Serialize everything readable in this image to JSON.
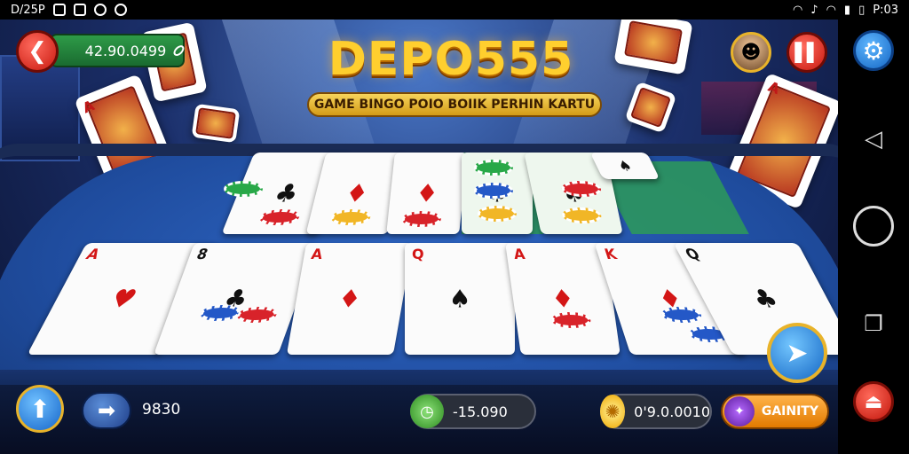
{
  "status_bar": {
    "time_left": "D/25P",
    "time_right": "P:03"
  },
  "title": {
    "logo": "DEPO555",
    "subtitle": "GAME BINGO POIO BOIIK PERHIN KARTU"
  },
  "top": {
    "balance": "42.90.0499"
  },
  "bottom": {
    "bet_value": "9830",
    "green_pill_value": "-15.090",
    "sun_pill_value": "0'9.0.0010",
    "action_label": "GAINITY"
  },
  "top_row_cards": [
    {
      "rank": "",
      "emblem": "♣"
    },
    {
      "rank": "",
      "emblem": "♦"
    },
    {
      "rank": "",
      "emblem": "♦"
    },
    {
      "rank": "",
      "emblem": "♠"
    },
    {
      "rank": "",
      "emblem": "♠"
    },
    {
      "rank": "",
      "emblem": "♠"
    }
  ],
  "bottom_row_cards": [
    {
      "rank": "A",
      "emblem": "♥"
    },
    {
      "rank": "8",
      "emblem": "♣"
    },
    {
      "rank": "A",
      "emblem": "♦"
    },
    {
      "rank": "Q",
      "emblem": "♠"
    },
    {
      "rank": "A",
      "emblem": "♦"
    },
    {
      "rank": "K",
      "emblem": "♦"
    },
    {
      "rank": "Q",
      "emblem": "♣"
    }
  ],
  "icons": {
    "back": "arrow-left-icon",
    "pause": "pause-icon",
    "settings": "gear-icon",
    "up": "arrow-up-icon",
    "next": "arrow-right-icon",
    "play": "arrow-cursor-icon"
  },
  "colors": {
    "accent_gold": "#ffcf2e",
    "table_blue": "#2f67c5",
    "button_red": "#c8190f",
    "button_blue": "#1466c4"
  }
}
